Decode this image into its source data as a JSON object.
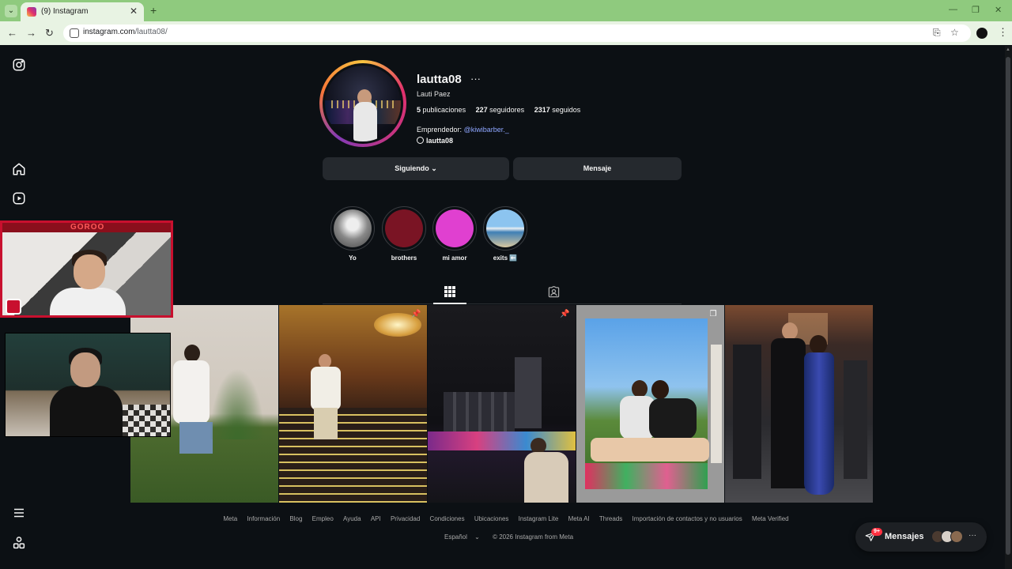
{
  "browser": {
    "tab_title": "(9) Instagram",
    "url_domain": "instagram.com",
    "url_path": "/lautta08/"
  },
  "profile": {
    "username": "lautta08",
    "full_name": "Lauti Paez",
    "posts_count": "5",
    "posts_label": "publicaciones",
    "followers_count": "227",
    "followers_label": "seguidores",
    "following_count": "2317",
    "following_label": "seguidos",
    "bio_prefix": "Emprendedor:",
    "bio_link": "@kiwibarber._",
    "threads_handle": "lautta08",
    "follow_button": "Siguiendo",
    "message_button": "Mensaje"
  },
  "highlights": [
    {
      "label": "Yo",
      "color": "#9a9a9a"
    },
    {
      "label": "brothers",
      "color": "#7a1424"
    },
    {
      "label": "mi amor",
      "color": "#e040d0"
    },
    {
      "label": "exits ⬅️",
      "color": "#6aa6d8"
    }
  ],
  "cam_overlay_text": "GOROO",
  "footer": {
    "links": [
      "Meta",
      "Información",
      "Blog",
      "Empleo",
      "Ayuda",
      "API",
      "Privacidad",
      "Condiciones",
      "Ubicaciones",
      "Instagram Lite",
      "Meta AI",
      "Threads",
      "Importación de contactos y no usuarios",
      "Meta Verified"
    ],
    "language": "Español",
    "copyright": "© 2026 Instagram from Meta"
  },
  "messages": {
    "label": "Mensajes",
    "badge": "9+"
  }
}
